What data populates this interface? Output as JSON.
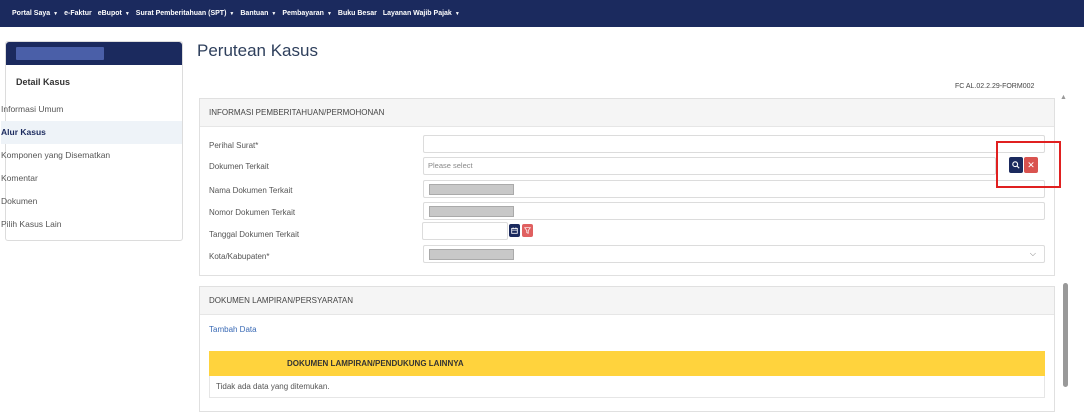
{
  "nav": {
    "items": [
      {
        "label": "Portal Saya",
        "caret": true
      },
      {
        "label": "e-Faktur",
        "caret": false
      },
      {
        "label": "eBupot",
        "caret": true
      },
      {
        "label": "Surat Pemberitahuan (SPT)",
        "caret": true
      },
      {
        "label": "Bantuan",
        "caret": true
      },
      {
        "label": "Pembayaran",
        "caret": true
      },
      {
        "label": "Buku Besar",
        "caret": false
      },
      {
        "label": "Layanan Wajib Pajak",
        "caret": true
      }
    ]
  },
  "sidebar": {
    "title": "Detail Kasus",
    "items": [
      {
        "label": "Informasi Umum",
        "active": false
      },
      {
        "label": "Alur Kasus",
        "active": true
      },
      {
        "label": "Komponen yang Disematkan",
        "active": false
      },
      {
        "label": "Komentar",
        "active": false
      },
      {
        "label": "Dokumen",
        "active": false
      },
      {
        "label": "Pilih Kasus Lain",
        "active": false
      }
    ]
  },
  "page": {
    "title": "Perutean Kasus",
    "form_code": "FC AL.02.2.29-FORM002"
  },
  "section1": {
    "title": "INFORMASI PEMBERITAHUAN/PERMOHONAN",
    "fields": {
      "perihal_label": "Perihal Surat*",
      "dokumen_label": "Dokumen Terkait",
      "dokumen_placeholder": "Please select",
      "nama_label": "Nama Dokumen Terkait",
      "nomor_label": "Nomor Dokumen Terkait",
      "tanggal_label": "Tanggal Dokumen Terkait",
      "kota_label": "Kota/Kabupaten*"
    }
  },
  "section2": {
    "title": "DOKUMEN LAMPIRAN/PERSYARATAN",
    "add_link": "Tambah Data",
    "table_header": "DOKUMEN LAMPIRAN/PENDUKUNG LAINNYA",
    "empty_text": "Tidak ada data yang ditemukan."
  },
  "icons": {
    "search": "search-icon",
    "clear": "close-icon",
    "calendar": "calendar-icon",
    "filter": "filter-clear-icon",
    "dropdown": "chevron-down-icon"
  },
  "colors": {
    "nav_bg": "#1b2a5e",
    "accent_red": "#d9534f",
    "highlight_bar": "#ffd33d",
    "link": "#3a6ab5"
  }
}
